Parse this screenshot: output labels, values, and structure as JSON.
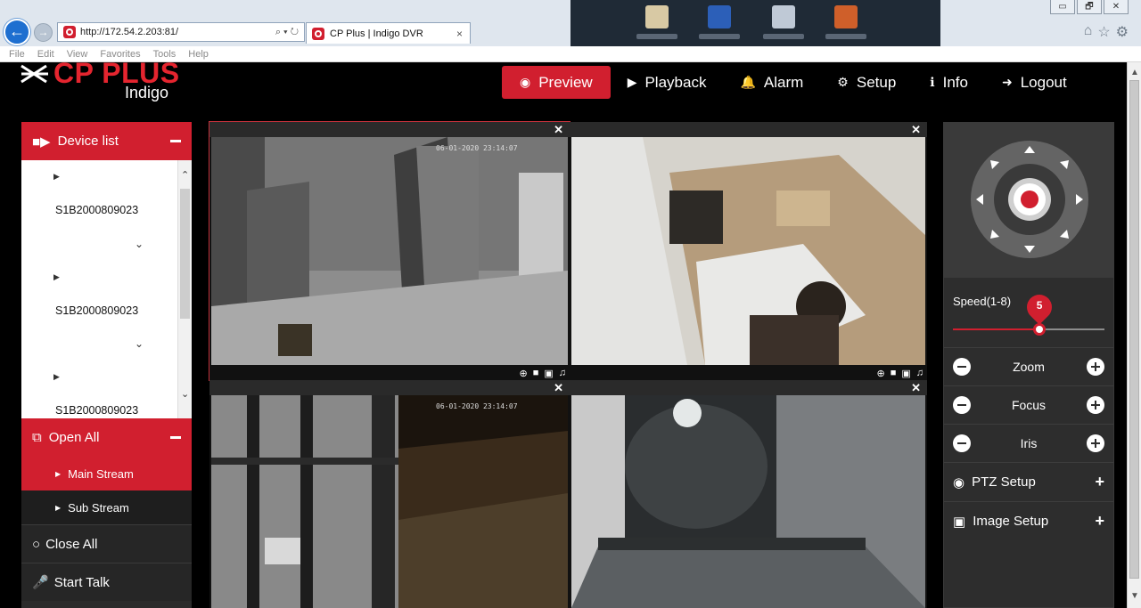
{
  "browser": {
    "back_icon": "arrow-left-icon",
    "address": "http://172.54.2.203:81/",
    "address_actions": "⌕ ▾ ↻",
    "tab_title": "CP Plus | Indigo DVR",
    "tab_close": "×",
    "menu": [
      "File",
      "Edit",
      "View",
      "Favorites",
      "Tools",
      "Help"
    ],
    "window_buttons": [
      "▭",
      "🗗",
      "✕"
    ],
    "right_icons": [
      "home-icon",
      "star-icon",
      "gear-icon"
    ]
  },
  "logo": {
    "main": "CP PLUS",
    "sub": "Indigo"
  },
  "nav": [
    {
      "label": "Preview",
      "icon": "eye-icon",
      "glyph": "◉",
      "active": true
    },
    {
      "label": "Playback",
      "icon": "play-icon",
      "glyph": "▶",
      "active": false
    },
    {
      "label": "Alarm",
      "icon": "bell-icon",
      "glyph": "🔔",
      "active": false
    },
    {
      "label": "Setup",
      "icon": "gear-icon",
      "glyph": "⚙",
      "active": false
    },
    {
      "label": "Info",
      "icon": "info-icon",
      "glyph": "ℹ",
      "active": false
    },
    {
      "label": "Logout",
      "icon": "logout-icon",
      "glyph": "➜",
      "active": false
    }
  ],
  "left_panel": {
    "device_list_label": "Device list",
    "devices": [
      "S1B2000809023",
      "S1B2000809023",
      "S1B2000809023"
    ],
    "open_all_label": "Open All",
    "main_stream_label": "Main Stream",
    "sub_stream_label": "Sub Stream",
    "close_all_label": "Close All",
    "start_talk_label": "Start Talk"
  },
  "cameras": [
    {
      "timestamp": "06-01-2020 23:14:07",
      "selected": true
    },
    {
      "timestamp": "",
      "selected": false
    },
    {
      "timestamp": "06-01-2020 23:14:07",
      "selected": false
    },
    {
      "timestamp": "",
      "selected": false
    }
  ],
  "camera_close": "✕",
  "ptz": {
    "speed_label": "Speed(1-8)",
    "speed_value": "5",
    "speed_min": 1,
    "speed_max": 8,
    "rows": [
      "Zoom",
      "Focus",
      "Iris"
    ],
    "ptz_setup_label": "PTZ Setup",
    "image_setup_label": "Image Setup",
    "expand_glyph": "+"
  },
  "colors": {
    "accent": "#d11f2f",
    "panel": "#2d2d2d",
    "background": "#000000"
  }
}
